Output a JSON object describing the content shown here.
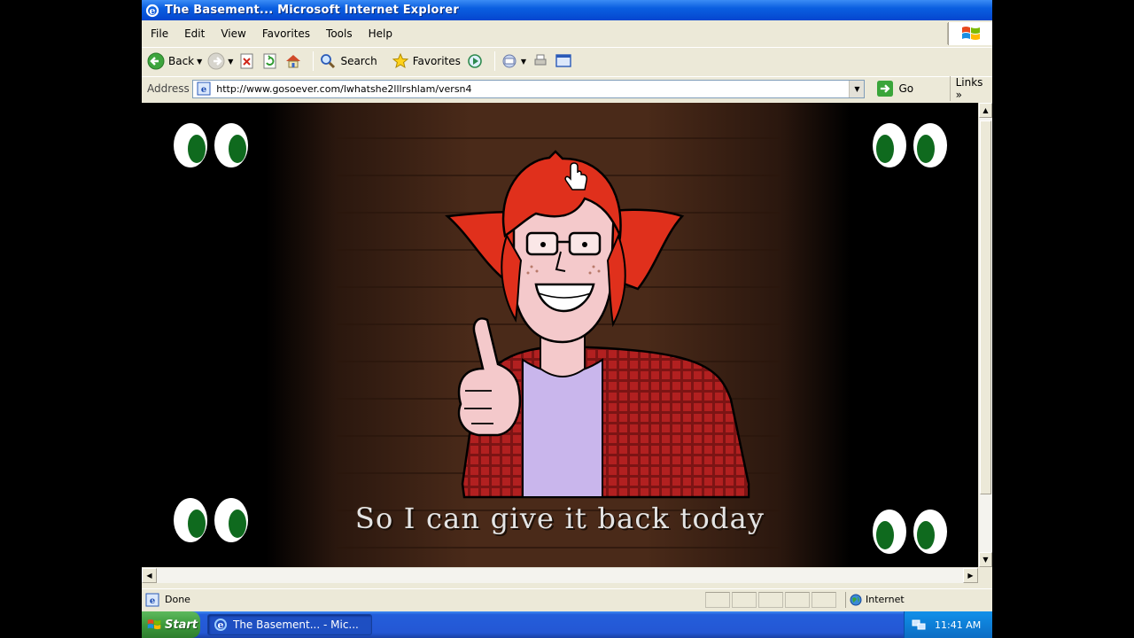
{
  "window": {
    "title": "The Basement... - Microsoft Internet Explorer",
    "title_display": "The Basement...   Microsoft Internet Explorer"
  },
  "menu": {
    "items": [
      "File",
      "Edit",
      "View",
      "Favorites",
      "Tools",
      "Help"
    ]
  },
  "toolbar": {
    "back_label": "Back",
    "search_label": "Search",
    "favorites_label": "Favorites"
  },
  "address": {
    "label": "Address",
    "url": "http://www.gosoever.com/lwhatshe2lllrshlam/versn4",
    "go_label": "Go",
    "links_label": "Links"
  },
  "content": {
    "caption": "So I can give it back today"
  },
  "status": {
    "text": "Done",
    "zone_label": "Internet"
  },
  "taskbar": {
    "start_label": "Start",
    "task_label": "The Basement... - Mic...",
    "clock": "11:41 AM"
  },
  "colors": {
    "titlebar": "#0a5fe0",
    "wood": "#3b2216",
    "hair": "#e0301c",
    "shirt": "#b22020",
    "tshirt": "#c9b6ec",
    "eye_pupil": "#0f6a1e"
  }
}
